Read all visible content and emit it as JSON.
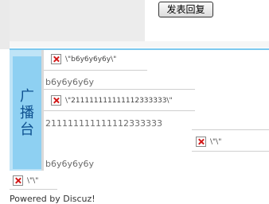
{
  "toolbar": {
    "post_reply_label": "发表回复"
  },
  "side_tab": {
    "label_chars": [
      "广",
      "播",
      "台"
    ]
  },
  "posts": [
    {
      "image_alt": "\\\"b6y6y6y6y\\\"",
      "text": "b6y6y6y6y"
    },
    {
      "image_alt": "\\\"211111111111112333333\\\"",
      "text": "211111111111112333333"
    },
    {
      "image_alt": "\\\"\\\"",
      "text": "b6y6y6y6y"
    }
  ],
  "bottom_image_alt": "\\\"\\\"",
  "footer": {
    "powered_by": "Powered by Discuz!"
  },
  "colors": {
    "panel_bg": "#bfe4f7",
    "tab_bg": "#8ed0f2",
    "tab_text": "#0d4f8f",
    "broken_icon": "#d21818"
  }
}
